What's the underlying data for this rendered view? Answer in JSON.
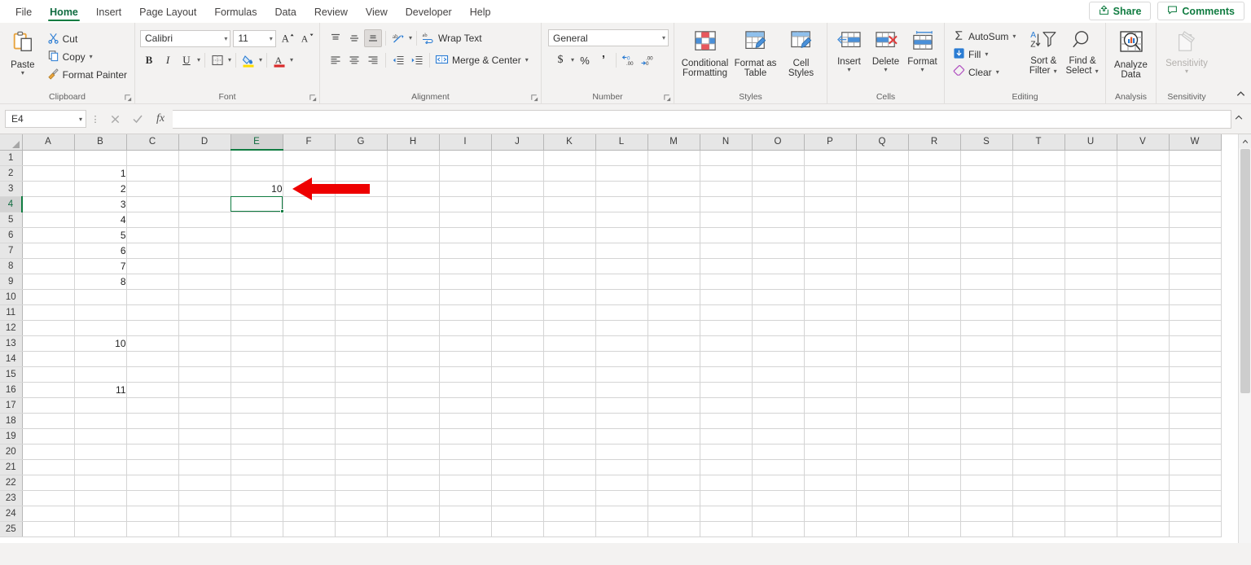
{
  "app": {
    "tabs": [
      {
        "label": "File",
        "active": false
      },
      {
        "label": "Home",
        "active": true
      },
      {
        "label": "Insert",
        "active": false
      },
      {
        "label": "Page Layout",
        "active": false
      },
      {
        "label": "Formulas",
        "active": false
      },
      {
        "label": "Data",
        "active": false
      },
      {
        "label": "Review",
        "active": false
      },
      {
        "label": "View",
        "active": false
      },
      {
        "label": "Developer",
        "active": false
      },
      {
        "label": "Help",
        "active": false
      }
    ],
    "share_label": "Share",
    "comments_label": "Comments",
    "accent_green": "#107c41"
  },
  "ribbon": {
    "clipboard": {
      "group_label": "Clipboard",
      "paste_label": "Paste",
      "cut_label": "Cut",
      "copy_label": "Copy",
      "format_painter_label": "Format Painter"
    },
    "font": {
      "group_label": "Font",
      "font_name": "Calibri",
      "font_size": "11",
      "grow_font": "A",
      "shrink_font": "A",
      "bold": "B",
      "italic": "I",
      "underline": "U"
    },
    "alignment": {
      "group_label": "Alignment",
      "wrap_text_label": "Wrap Text",
      "merge_center_label": "Merge & Center"
    },
    "number": {
      "group_label": "Number",
      "format_value": "General",
      "currency": "$",
      "percent": "%",
      "comma": "’"
    },
    "styles": {
      "group_label": "Styles",
      "conditional_formatting_label": "Conditional\nFormatting",
      "conditional_formatting_line1": "Conditional",
      "conditional_formatting_line2": "Formatting",
      "format_as_table_line1": "Format as",
      "format_as_table_line2": "Table",
      "cell_styles_line1": "Cell",
      "cell_styles_line2": "Styles"
    },
    "cells": {
      "group_label": "Cells",
      "insert_label": "Insert",
      "delete_label": "Delete",
      "format_label": "Format"
    },
    "editing": {
      "group_label": "Editing",
      "autosum_label": "AutoSum",
      "fill_label": "Fill",
      "clear_label": "Clear",
      "sort_filter_line1": "Sort &",
      "sort_filter_line2": "Filter",
      "find_select_line1": "Find &",
      "find_select_line2": "Select"
    },
    "analysis": {
      "group_label": "Analysis",
      "analyze_data_line1": "Analyze",
      "analyze_data_line2": "Data"
    },
    "sensitivity": {
      "group_label": "Sensitivity",
      "sensitivity_label": "Sensitivity"
    }
  },
  "formula_bar": {
    "name_box_value": "E4",
    "formula_value": "",
    "cancel_symbol": "✕",
    "confirm_symbol": "✓",
    "fx_symbol": "fx"
  },
  "sheet": {
    "columns": [
      "A",
      "B",
      "C",
      "D",
      "E",
      "F",
      "G",
      "H",
      "I",
      "J",
      "K",
      "L",
      "M",
      "N",
      "O",
      "P",
      "Q",
      "R",
      "S",
      "T",
      "U",
      "V",
      "W"
    ],
    "highlighted_column": "E",
    "rows": [
      1,
      2,
      3,
      4,
      5,
      6,
      7,
      8,
      9,
      10,
      11,
      12,
      13,
      14,
      15,
      16,
      17,
      18,
      19,
      20,
      21,
      22,
      23,
      24,
      25
    ],
    "highlighted_row": 4,
    "selected_cell": "E4",
    "cell_values": {
      "B2": "1",
      "B3": "2",
      "B4": "3",
      "B5": "4",
      "B6": "5",
      "B7": "6",
      "B8": "7",
      "B9": "8",
      "B13": "10",
      "B16": "11",
      "E3": "10"
    },
    "annotation": {
      "type": "arrow",
      "direction": "left",
      "color": "#ee0000",
      "points_at": "E3"
    }
  }
}
